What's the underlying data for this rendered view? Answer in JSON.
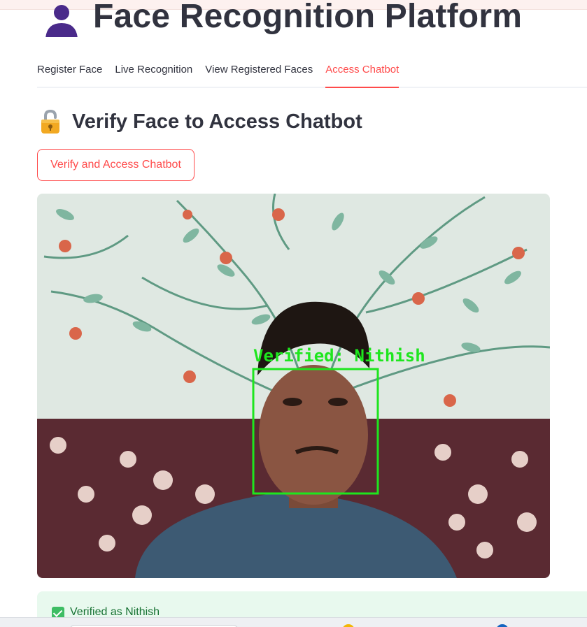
{
  "app": {
    "title": "Face Recognition Platform",
    "icon": "user-silhouette-icon"
  },
  "tabs": [
    {
      "label": "Register Face",
      "active": false
    },
    {
      "label": "Live Recognition",
      "active": false
    },
    {
      "label": "View Registered Faces",
      "active": false
    },
    {
      "label": "Access Chatbot",
      "active": true
    }
  ],
  "section": {
    "icon": "lock-icon",
    "title": "Verify Face to Access Chatbot"
  },
  "verify_button": {
    "label": "Verify and Access Chatbot"
  },
  "camera": {
    "overlay_label": "Verified: Nithish",
    "box_color": "#1ee61e"
  },
  "status": {
    "icon": "check-icon",
    "message": "Verified as Nithish"
  },
  "colors": {
    "accent": "#ff4b4b",
    "text": "#31333f",
    "success_bg": "#e8f9ee",
    "success_text": "#177233"
  }
}
